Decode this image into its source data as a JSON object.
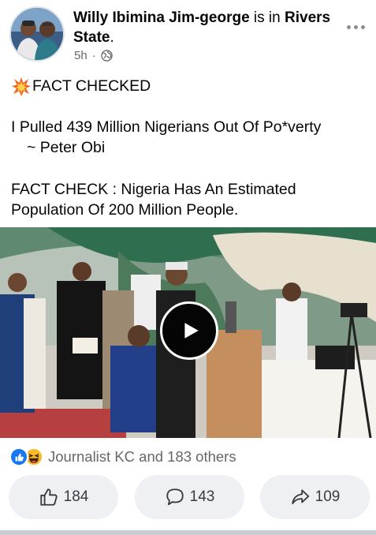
{
  "post": {
    "author": "Willy Ibimina Jim-george",
    "is_in": " is in ",
    "location": "Rivers State",
    "location_suffix": ".",
    "time": "5h",
    "separator": "·",
    "privacy_icon": "globe-icon",
    "more_icon": "more-options-icon"
  },
  "content": {
    "line1_emoji": "collision-emoji",
    "line1": "FACT CHECKED",
    "line2": "I Pulled 439 Million Nigerians Out Of Po*verty",
    "line3": "~ Peter Obi",
    "line4": "FACT CHECK : Nigeria Has An Estimated",
    "line5": "Population Of 200 Million People."
  },
  "video": {
    "play_icon": "play-icon"
  },
  "reactions": {
    "icons": [
      "like-reaction-icon",
      "haha-reaction-icon"
    ],
    "summary": "Journalist KC and 183 others"
  },
  "actions": {
    "like_count": "184",
    "comment_count": "143",
    "share_count": "109"
  },
  "colors": {
    "facebook_blue": "#1877f2",
    "secondary_text": "#65676b",
    "button_bg": "#eef0f3"
  }
}
